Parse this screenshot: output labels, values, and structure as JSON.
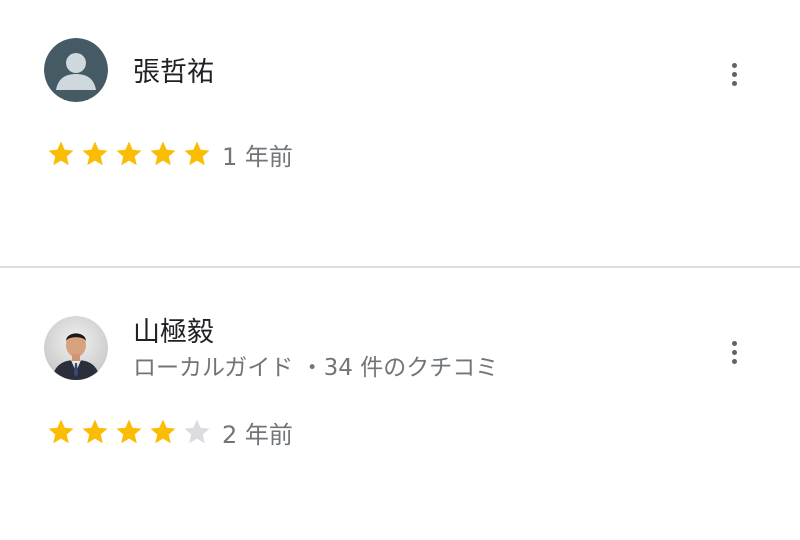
{
  "reviews": [
    {
      "name": "張哲祐",
      "subtitle": "",
      "rating": 5,
      "max_rating": 5,
      "time_ago": "1 年前",
      "avatar": "default-person-icon"
    },
    {
      "name": "山極毅",
      "subtitle": "ローカルガイド ・34 件のクチコミ",
      "rating": 4,
      "max_rating": 5,
      "time_ago": "2 年前",
      "avatar": "user-photo"
    }
  ],
  "colors": {
    "star_filled": "#fbbc04",
    "star_empty": "#dadce0",
    "avatar_default_bg": "#455a64",
    "avatar_default_fg": "#cfd8dc",
    "divider": "#dadce0"
  },
  "icons": {
    "more": "more-vert-icon",
    "star": "star-icon"
  }
}
